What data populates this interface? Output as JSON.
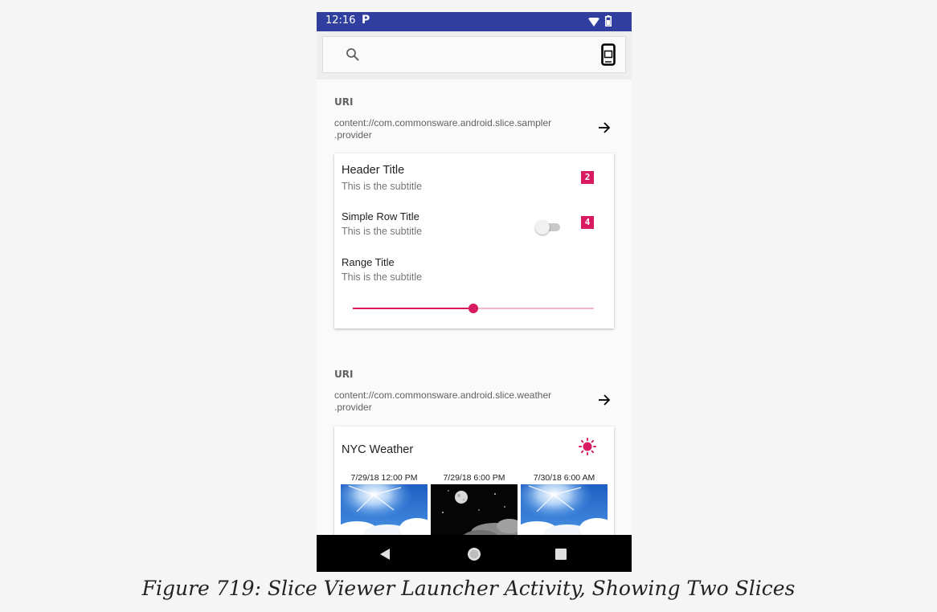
{
  "status_bar": {
    "time": "12:16",
    "notification_glyph": "P",
    "icons": [
      "wifi-icon",
      "battery-icon"
    ],
    "background": "#303f9f"
  },
  "toolbar": {
    "search_icon": "search-icon",
    "mode_icon": "phone-mode-icon"
  },
  "slices": [
    {
      "uri_label": "URI",
      "uri": "content://com.commonsware.android.slice.sampler\n.provider",
      "open_icon": "arrow-right-icon",
      "rows": [
        {
          "title": "Header Title",
          "subtitle": "This is the subtitle",
          "badge": "2"
        },
        {
          "title": "Simple Row Title",
          "subtitle": "This is the subtitle",
          "badge": "4",
          "toggle_on": false
        },
        {
          "title": "Range Title",
          "subtitle": "This is the subtitle",
          "range_value": 0.5
        }
      ]
    },
    {
      "uri_label": "URI",
      "uri": "content://com.commonsware.android.slice.weather\n.provider",
      "open_icon": "arrow-right-icon",
      "title": "NYC Weather",
      "header_icon": "sun-icon",
      "forecasts": [
        {
          "time": "7/29/18 12:00 PM",
          "image": "sunny-sky-image"
        },
        {
          "time": "7/29/18 6:00 PM",
          "image": "night-moon-image"
        },
        {
          "time": "7/30/18 6:00 AM",
          "image": "sunny-sky-image"
        }
      ]
    }
  ],
  "nav_bar": {
    "buttons": [
      "back-icon",
      "home-icon",
      "recents-icon"
    ]
  },
  "accent_color": "#d81b60",
  "caption": "Figure 719: Slice Viewer Launcher Activity, Showing Two Slices"
}
